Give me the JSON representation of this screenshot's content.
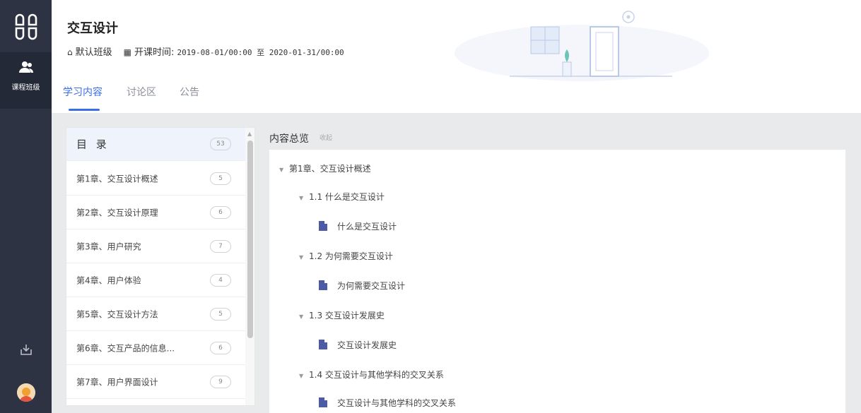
{
  "rail": {
    "nav_label": "课程班级"
  },
  "course": {
    "title": "交互设计",
    "class_name": "默认班级",
    "time_label": "开课时间:",
    "time_range": "2019-08-01/00:00 至 2020-01-31/00:00"
  },
  "tabs": [
    {
      "label": "学习内容"
    },
    {
      "label": "讨论区"
    },
    {
      "label": "公告"
    }
  ],
  "toc": {
    "header": {
      "label": "目 录",
      "count": "53"
    },
    "items": [
      {
        "label": "第1章、交互设计概述",
        "count": "5"
      },
      {
        "label": "第2章、交互设计原理",
        "count": "6"
      },
      {
        "label": "第3章、用户研究",
        "count": "7"
      },
      {
        "label": "第4章、用户体验",
        "count": "4"
      },
      {
        "label": "第5章、交互设计方法",
        "count": "5"
      },
      {
        "label": "第6章、交互产品的信息...",
        "count": "6"
      },
      {
        "label": "第7章、用户界面设计",
        "count": "9"
      }
    ]
  },
  "overview": {
    "title": "内容总览",
    "collapse": "收起",
    "tree": [
      {
        "label": "第1章、交互设计概述"
      },
      {
        "label": "1.1 什么是交互设计"
      },
      {
        "label": "什么是交互设计"
      },
      {
        "label": "1.2 为何需要交互设计"
      },
      {
        "label": "为何需要交互设计"
      },
      {
        "label": "1.3 交互设计发展史"
      },
      {
        "label": "交互设计发展史"
      },
      {
        "label": "1.4 交互设计与其他学科的交叉关系"
      },
      {
        "label": "交互设计与其他学科的交叉关系"
      }
    ]
  },
  "colors": {
    "rail": "#2d3342",
    "accent": "#3a6fe8",
    "doc_icon": "#4b5ba8"
  },
  "icons": [
    "app-logo-icon",
    "users-icon",
    "download-icon",
    "avatar",
    "home-icon",
    "calendar-icon",
    "doc-icon",
    "caret-down-icon"
  ]
}
